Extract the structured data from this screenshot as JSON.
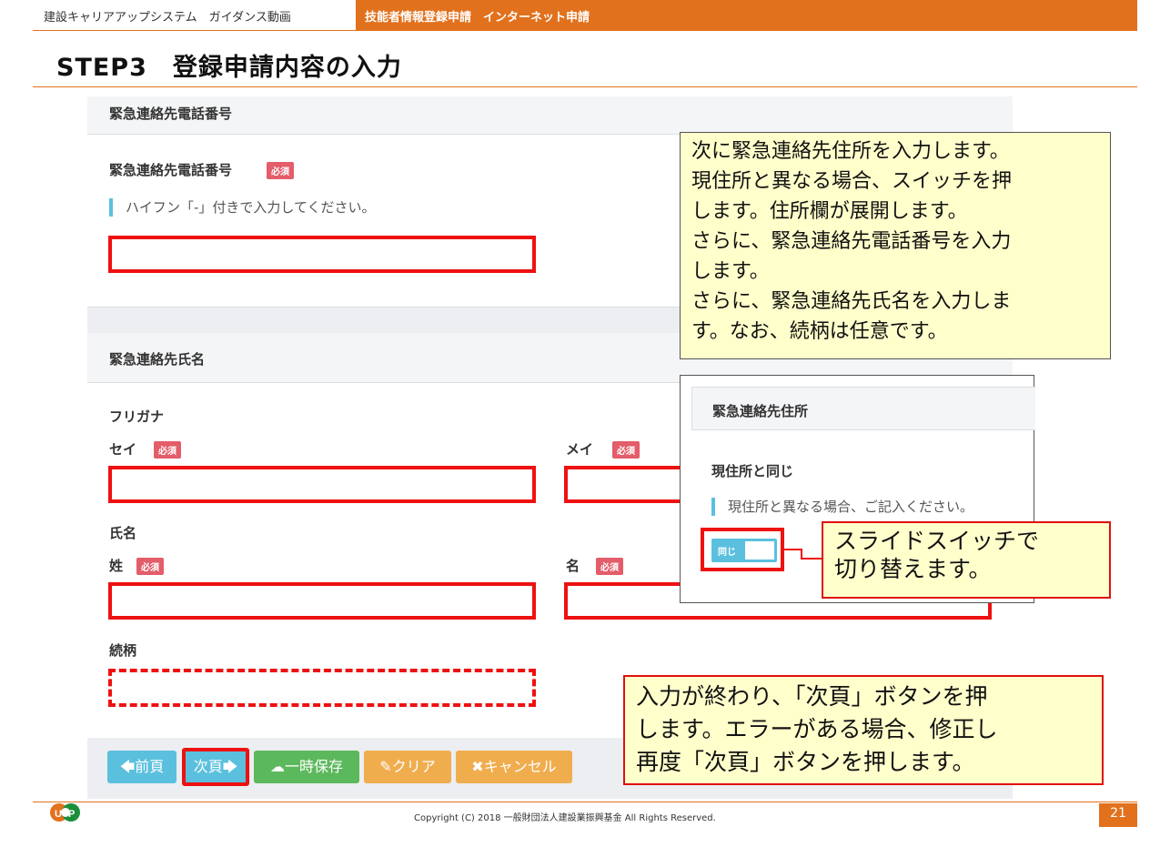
{
  "header": {
    "left_title": "建設キャリアアップシステム　ガイダンス動画",
    "right_title": "技能者情報登録申請　インターネット申請"
  },
  "step_title": "STEP3　登録申請内容の入力",
  "phone_section": {
    "title": "緊急連絡先電話番号",
    "field_label": "緊急連絡先電話番号",
    "required": "必須",
    "hint": "ハイフン「-」付きで入力してください。"
  },
  "name_section": {
    "title": "緊急連絡先氏名",
    "furigana_label": "フリガナ",
    "sei_label": "セイ",
    "mei_label": "メイ",
    "shimei_label": "氏名",
    "sei_kanji_label": "姓",
    "mei_kanji_label": "名",
    "relation_label": "続柄",
    "required": "必須"
  },
  "buttons": {
    "prev": "前頁",
    "next": "次頁",
    "save": "一時保存",
    "clear": "クリア",
    "cancel": "キャンセル"
  },
  "note_top": {
    "lines": [
      "次に緊急連絡先住所を入力します。",
      "現住所と異なる場合、スイッチを押",
      "します。住所欄が展開します。",
      "さらに、緊急連絡先電話番号を入力",
      "します。",
      "さらに、緊急連絡先氏名を入力しま",
      "す。なお、続柄は任意です。"
    ]
  },
  "popup": {
    "title": "緊急連絡先住所",
    "label": "現住所と同じ",
    "hint": "現住所と異なる場合、ご記入ください。",
    "toggle_text": "同じ"
  },
  "note_switch": {
    "lines": [
      "スライドスイッチで",
      "切り替えます。"
    ]
  },
  "note_bottom": {
    "lines": [
      "入力が終わり、「次頁」ボタンを押",
      "します。エラーがある場合、修正し",
      "再度「次頁」ボタンを押します。"
    ]
  },
  "footer": {
    "copyright": "Copyright (C) 2018 一般財団法人建設業振興基金 All Rights Reserved.",
    "page_number": "21"
  },
  "colors": {
    "accent": "#e2711d",
    "highlight_red": "#ee1111",
    "btn_prev": "#5bc0de",
    "btn_save": "#5cb85c",
    "btn_warn": "#f0ad4e"
  }
}
